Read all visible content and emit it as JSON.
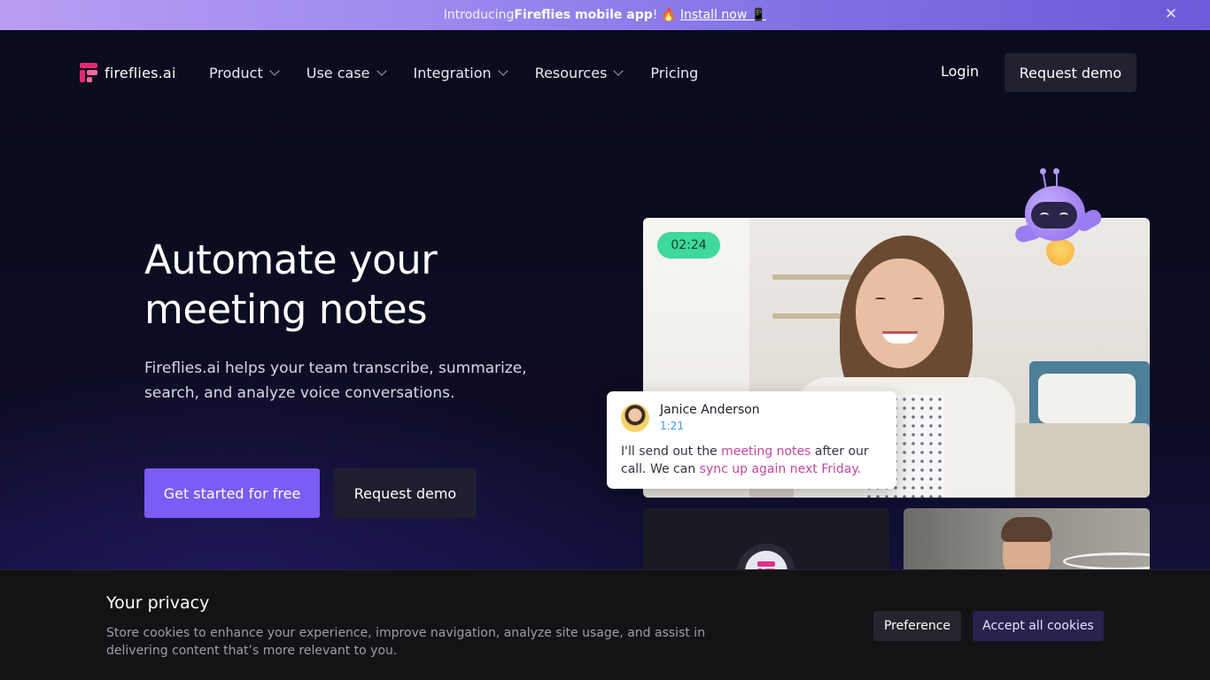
{
  "announcement": {
    "prefix": "Introducing ",
    "app_name": "Fireflies mobile app",
    "suffix": "!",
    "fire_emoji": "🔥",
    "link_text": "Install now 📱",
    "close_icon": "close-icon"
  },
  "nav": {
    "logo_text": "fireflies.ai",
    "items": [
      {
        "label": "Product",
        "has_dropdown": true
      },
      {
        "label": "Use case",
        "has_dropdown": true
      },
      {
        "label": "Integration",
        "has_dropdown": true
      },
      {
        "label": "Resources",
        "has_dropdown": true
      },
      {
        "label": "Pricing",
        "has_dropdown": false
      }
    ],
    "login": "Login",
    "request_demo": "Request demo"
  },
  "hero": {
    "title_line1": "Automate your",
    "title_line2": "meeting notes",
    "subtitle": "Fireflies.ai helps your team transcribe, summarize, search, and analyze voice conversations.",
    "cta_primary": "Get started for free",
    "cta_secondary": "Request demo"
  },
  "video": {
    "timer": "02:24",
    "chat": {
      "name": "Janice Anderson",
      "time": "1:21",
      "text_part1": "I'll send out the ",
      "highlight1": "meeting notes",
      "text_part2": " after our call. We can ",
      "highlight2": "sync up again next Friday."
    }
  },
  "cookie": {
    "title": "Your privacy",
    "text": "Store cookies to enhance your experience, improve navigation, analyze site usage, and assist in delivering content that’s more relevant to you.",
    "preference": "Preference",
    "accept": "Accept all cookies"
  },
  "colors": {
    "brand_purple": "#7b5cf5",
    "brand_pink": "#e8286e",
    "timer_green": "#3fd99b",
    "highlight_magenta": "#c047a0"
  }
}
